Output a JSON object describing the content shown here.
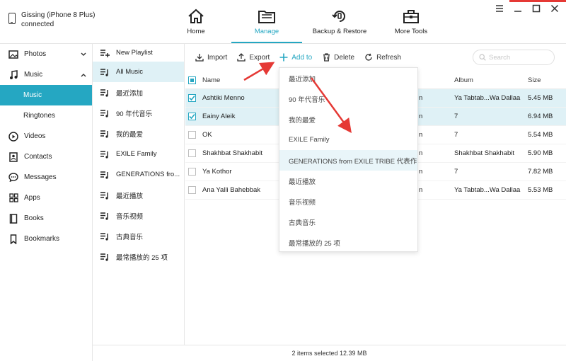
{
  "device": {
    "name": "Gissing (iPhone 8 Plus)",
    "status": "connected"
  },
  "nav": {
    "home": "Home",
    "manage": "Manage",
    "backup": "Backup & Restore",
    "tools": "More Tools"
  },
  "sidebar": {
    "items": [
      {
        "label": "Photos"
      },
      {
        "label": "Music"
      },
      {
        "label": "Music"
      },
      {
        "label": "Ringtones"
      },
      {
        "label": "Videos"
      },
      {
        "label": "Contacts"
      },
      {
        "label": "Messages"
      },
      {
        "label": "Apps"
      },
      {
        "label": "Books"
      },
      {
        "label": "Bookmarks"
      }
    ]
  },
  "playlists": {
    "new_label": "New Playlist",
    "items": [
      "All Music",
      "最近添加",
      "90 年代音乐",
      "我的最爱",
      "EXILE Family",
      "GENERATIONS fro...",
      "最近播放",
      "音乐视频",
      "古典音乐",
      "最常播放的 25 项"
    ]
  },
  "toolbar": {
    "import": "Import",
    "export": "Export",
    "add_to": "Add to",
    "delete": "Delete",
    "refresh": "Refresh",
    "search_placeholder": "Search"
  },
  "table": {
    "headers": {
      "name": "Name",
      "album": "Album",
      "size": "Size"
    },
    "rows": [
      {
        "name": "Ashtiki Menno",
        "artist_tail": "n",
        "album": "Ya Tabtab...Wa Dallaa",
        "size": "5.45 MB",
        "checked": true
      },
      {
        "name": "Eainy Aleik",
        "artist_tail": "n",
        "album": "7",
        "size": "6.94 MB",
        "checked": true
      },
      {
        "name": "OK",
        "artist_tail": "n",
        "album": "7",
        "size": "5.54 MB",
        "checked": false
      },
      {
        "name": "Shakhbat Shakhabit",
        "artist_tail": "n",
        "album": "Shakhbat Shakhabit",
        "size": "5.90 MB",
        "checked": false
      },
      {
        "name": "Ya Kothor",
        "artist_tail": "n",
        "album": "7",
        "size": "7.82 MB",
        "checked": false
      },
      {
        "name": "Ana Yalli Bahebbak",
        "artist_tail": "n",
        "album": "Ya Tabtab...Wa Dallaa",
        "size": "5.53 MB",
        "checked": false
      }
    ]
  },
  "dropdown": {
    "items": [
      "最近添加",
      "90 年代音乐",
      "我的最爱",
      "EXILE Family",
      "GENERATIONS from EXILE TRIBE 代表作",
      "最近播放",
      "音乐视频",
      "古典音乐",
      "最常播放的 25 项"
    ]
  },
  "status": {
    "text": "2 items selected 12.39 MB"
  },
  "colors": {
    "accent": "#25a7c2",
    "selected_row": "#dff1f6",
    "arrow": "#e53935"
  }
}
